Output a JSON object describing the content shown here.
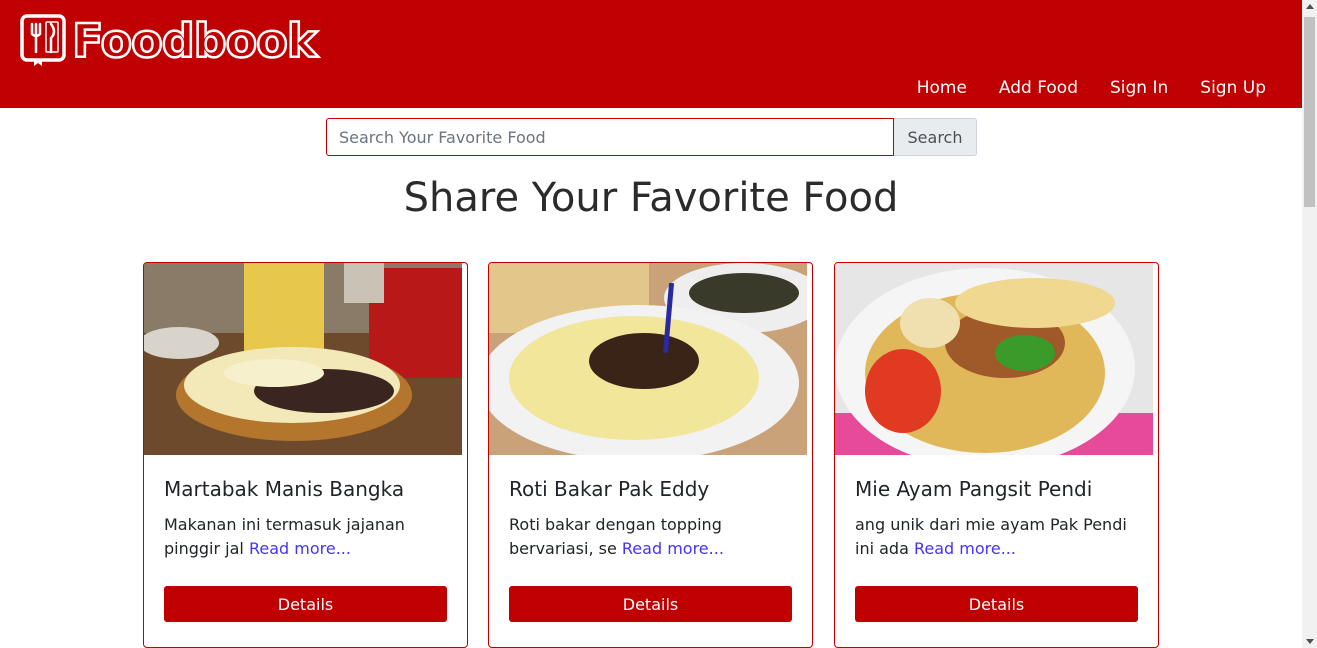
{
  "brand": {
    "name": "Foodbook",
    "icon": "food-menu-book-icon"
  },
  "nav": {
    "items": [
      "Home",
      "Add Food",
      "Sign In",
      "Sign Up"
    ]
  },
  "search": {
    "placeholder": "Search Your Favorite Food",
    "button_label": "Search"
  },
  "page_title": "Share Your Favorite Food",
  "cards": [
    {
      "title": "Martabak Manis Bangka",
      "excerpt": "Makanan ini termasuk jajanan pinggir jal",
      "read_more": "Read more...",
      "button": "Details",
      "image": "martabak-manis-photo"
    },
    {
      "title": "Roti Bakar Pak Eddy",
      "excerpt": "Roti bakar dengan topping bervariasi, se",
      "read_more": "Read more...",
      "button": "Details",
      "image": "roti-bakar-photo"
    },
    {
      "title": "Mie Ayam Pangsit Pendi",
      "excerpt": "ang unik dari mie ayam Pak Pendi ini ada",
      "read_more": "Read more...",
      "button": "Details",
      "image": "mie-ayam-photo"
    }
  ],
  "colors": {
    "brand": "#c00000",
    "link": "#4433ff",
    "search_button_bg": "#e9ecef"
  }
}
